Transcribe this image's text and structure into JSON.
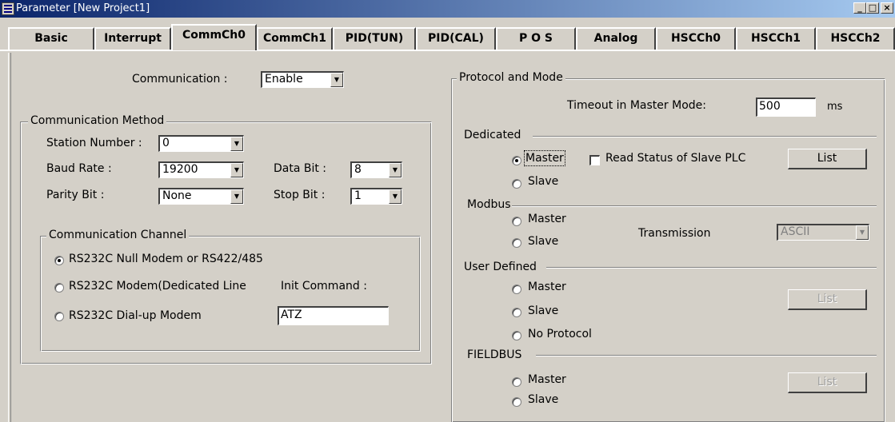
{
  "window": {
    "title": "Parameter [New Project1]",
    "icon": "parameter-app-icon",
    "controls": {
      "minimize": "_",
      "maximize": "□",
      "close": "×"
    }
  },
  "tabs": [
    {
      "label": "Basic",
      "active": false
    },
    {
      "label": "Interrupt",
      "active": false
    },
    {
      "label": "CommCh0",
      "active": true
    },
    {
      "label": "CommCh1",
      "active": false
    },
    {
      "label": "PID(TUN)",
      "active": false
    },
    {
      "label": "PID(CAL)",
      "active": false
    },
    {
      "label": "P O S",
      "active": false
    },
    {
      "label": "Analog",
      "active": false
    },
    {
      "label": "HSCCh0",
      "active": false
    },
    {
      "label": "HSCCh1",
      "active": false
    },
    {
      "label": "HSCCh2",
      "active": false
    }
  ],
  "communication": {
    "label": "Communication :",
    "value": "Enable"
  },
  "method": {
    "title": "Communication Method",
    "station_label": "Station Number :",
    "station_value": "0",
    "baud_label": "Baud Rate :",
    "baud_value": "19200",
    "databit_label": "Data Bit :",
    "databit_value": "8",
    "parity_label": "Parity Bit :",
    "parity_value": "None",
    "stopbit_label": "Stop Bit :",
    "stopbit_value": "1"
  },
  "channel": {
    "title": "Communication Channel",
    "opt1": "RS232C Null Modem or RS422/485",
    "opt2": "RS232C Modem(Dedicated Line",
    "opt3": "RS232C Dial-up Modem",
    "init_label": "Init Command :",
    "init_value": "ATZ",
    "selected": 1
  },
  "protocol": {
    "title": "Protocol and Mode",
    "timeout_label": "Timeout in Master Mode:",
    "timeout_value": "500",
    "timeout_unit": "ms",
    "dedicated": {
      "title": "Dedicated",
      "master": "Master",
      "slave": "Slave",
      "read_status": "Read Status of Slave PLC",
      "read_status_checked": false,
      "list_button": "List",
      "selected": "master"
    },
    "modbus": {
      "title": "Modbus",
      "master": "Master",
      "slave": "Slave",
      "transmission_label": "Transmission",
      "transmission_value": "ASCII"
    },
    "user_defined": {
      "title": "User Defined",
      "master": "Master",
      "slave": "Slave",
      "no_protocol": "No Protocol",
      "list_button": "List"
    },
    "fieldbus": {
      "title": "FIELDBUS",
      "master": "Master",
      "slave": "Slave",
      "list_button": "List"
    }
  },
  "colors": {
    "face": "#d4d0c8",
    "titlebar_start": "#0a246a",
    "titlebar_end": "#a6caf0"
  }
}
